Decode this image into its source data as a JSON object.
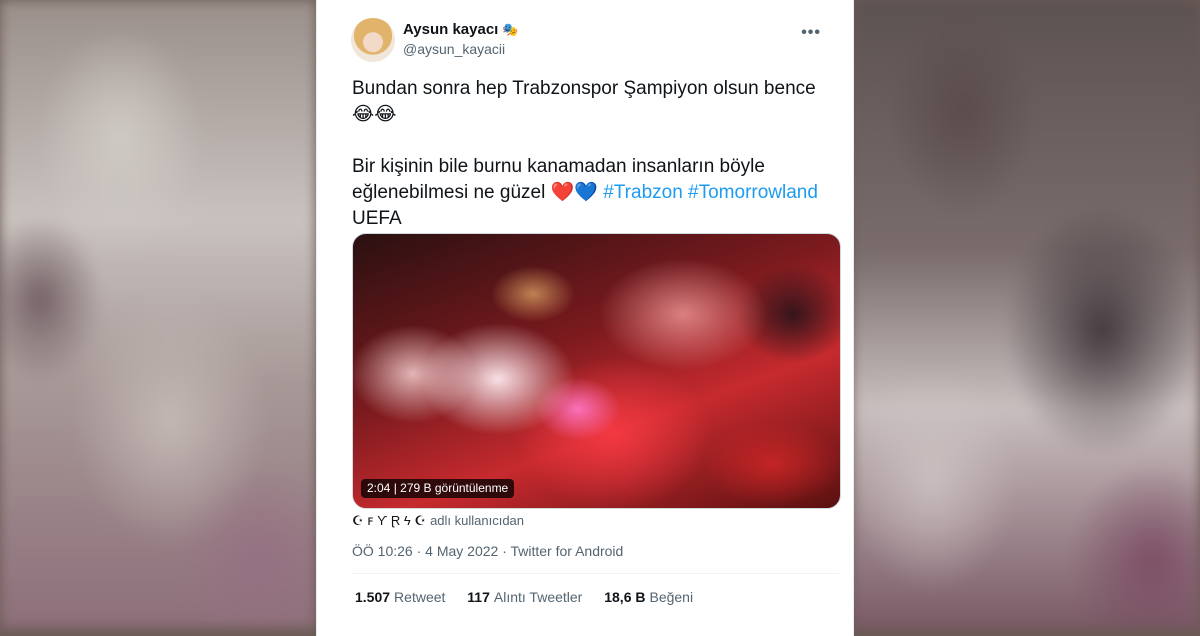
{
  "tweet": {
    "display_name": "Aysun kayacı",
    "name_badge": "🎭",
    "handle": "@aysun_kayacii",
    "more_icon": "•••",
    "text_line1": "Bundan sonra hep Trabzonspor Şampiyon olsun bence",
    "text_line2": "😂😂",
    "text_line3": "Bir kişinin bile burnu kanamadan insanların böyle",
    "text_line4_prefix": "eğlenebilmesi ne güzel",
    "heart_red": "❤️",
    "heart_blue": "💙",
    "hashtag1": "#Trabzon",
    "hashtag2": "#Tomorrowland",
    "text_line5": "UEFA",
    "video_duration": "2:04",
    "video_views": "279 B görüntülenme",
    "attribution_glyphs": "☪︎ ꜰ Ƴ Ɽ ϟ ☪︎",
    "attribution_text": "adlı kullanıcıdan",
    "meta": "ÖÖ 10:26 · 4 May 2022 · Twitter for Android",
    "retweets_count": "1.507",
    "retweets_label": "Retweet",
    "quotes_count": "117",
    "quotes_label": "Alıntı Tweetler",
    "likes_count": "18,6 B",
    "likes_label": "Beğeni"
  }
}
